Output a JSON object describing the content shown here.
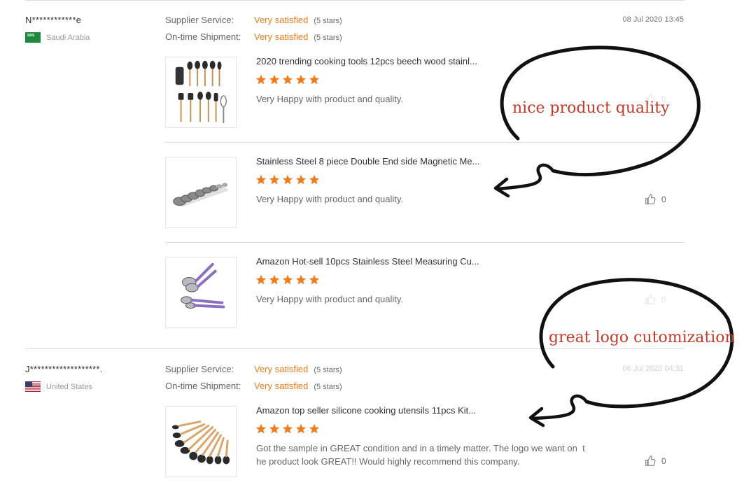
{
  "reviews": [
    {
      "buyer": "N************e",
      "country": "Saudi Arabia",
      "flag_label": "SRS",
      "supplier_service_label": "Supplier Service:",
      "supplier_service_value": "Very satisfied",
      "supplier_service_stars": "(5 stars)",
      "shipment_label": "On-time Shipment:",
      "shipment_value": "Very satisfied",
      "shipment_stars": "(5 stars)",
      "date": "08 Jul 2020 13:45",
      "products": [
        {
          "title": "2020 trending cooking tools 12pcs beech wood stainl...",
          "rating": 5,
          "text": "Very Happy with product and quality.",
          "likes": "0"
        },
        {
          "title": "Stainless Steel 8 piece Double End side Magnetic Me...",
          "rating": 5,
          "text": "Very Happy with product and quality.",
          "likes": "0"
        },
        {
          "title": "Amazon Hot-sell 10pcs Stainless Steel Measuring Cu...",
          "rating": 5,
          "text": "Very Happy with product and quality.",
          "likes": "0"
        }
      ]
    },
    {
      "buyer": "J*******************.",
      "country": "United States",
      "supplier_service_label": "Supplier Service:",
      "supplier_service_value": "Very satisfied",
      "supplier_service_stars": "(5 stars)",
      "shipment_label": "On-time Shipment:",
      "shipment_value": "Very satisfied",
      "shipment_stars": "(5 stars)",
      "date": "06 Jul 2020 04:31",
      "products": [
        {
          "title": "Amazon top seller silicone cooking utensils 11pcs Kit...",
          "rating": 5,
          "text_line1": "Got the sample in GREAT condition and in a timely matter. The logo we want on  t",
          "text_line2": "he product look GREAT!! Would highly recommend this company.",
          "likes": "0"
        }
      ]
    }
  ],
  "annotations": {
    "top": "nice product quality",
    "bottom": "great logo cutomization"
  },
  "colors": {
    "accent_orange": "#f07c1b",
    "annotation_red": "#c43a2a"
  },
  "icons": {
    "like": "thumbs-up-icon",
    "star": "star-icon"
  }
}
